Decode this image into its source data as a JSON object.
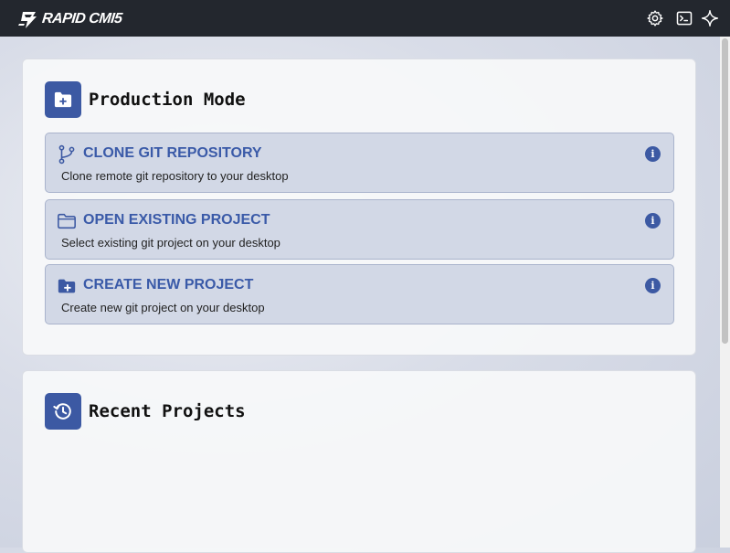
{
  "app": {
    "title": "RAPID CMI5",
    "toolbar": {
      "settings_icon": "gear-icon",
      "terminal_icon": "terminal-icon",
      "ai_icon": "sparkle-icon"
    }
  },
  "production": {
    "title": "Production Mode",
    "icon": "folder-plus-icon",
    "options": [
      {
        "title": "CLONE GIT REPOSITORY",
        "description": "Clone remote git repository to your desktop",
        "icon": "git-branch-icon",
        "info": "i"
      },
      {
        "title": "OPEN EXISTING PROJECT",
        "description": "Select existing git project on your desktop",
        "icon": "folder-open-icon",
        "info": "i"
      },
      {
        "title": "CREATE NEW PROJECT",
        "description": "Create new git project on your desktop",
        "icon": "folder-plus-icon",
        "info": "i"
      }
    ]
  },
  "recent": {
    "title": "Recent Projects",
    "icon": "history-icon"
  },
  "colors": {
    "titlebar": "#23272e",
    "accent": "#3c59a3",
    "option_bg": "#d2d8e6",
    "option_title": "#3a5aa8"
  }
}
